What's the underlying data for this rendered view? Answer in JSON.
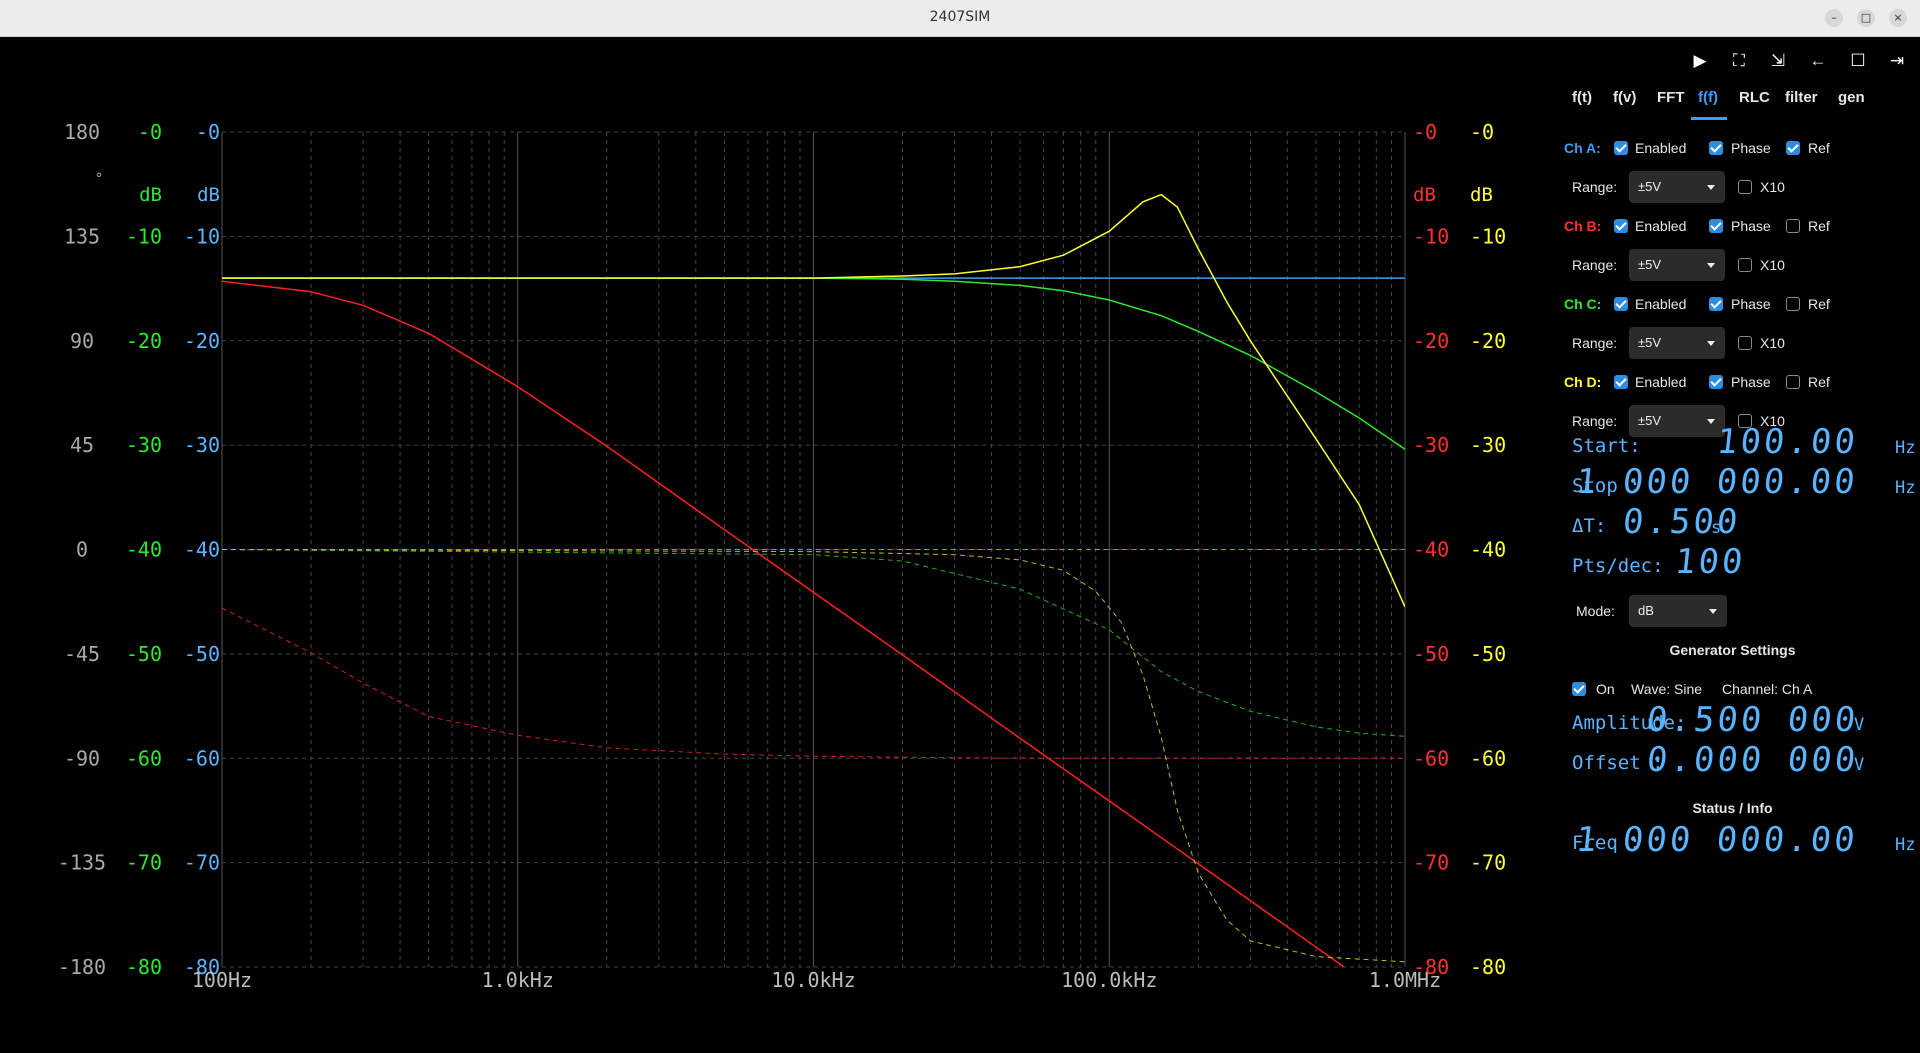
{
  "window": {
    "title": "2407SIM"
  },
  "toolbar": {
    "icons": [
      "play-icon",
      "fullscreen-icon",
      "collapse-icon",
      "back-arrow-icon",
      "window-icon",
      "exit-icon"
    ]
  },
  "tabs": [
    {
      "label": "f(t)"
    },
    {
      "label": "f(v)"
    },
    {
      "label": "FFT"
    },
    {
      "label": "f(f)",
      "active": true
    },
    {
      "label": "RLC"
    },
    {
      "label": "filter"
    },
    {
      "label": "gen"
    }
  ],
  "channels": [
    {
      "label": "Ch A:",
      "color": "#3a9ff5",
      "enabled": true,
      "phase": true,
      "ref": true,
      "range": "±5V",
      "x10": false
    },
    {
      "label": "Ch B:",
      "color": "#ff3030",
      "enabled": true,
      "phase": true,
      "ref": false,
      "range": "±5V",
      "x10": false
    },
    {
      "label": "Ch C:",
      "color": "#2ee82e",
      "enabled": true,
      "phase": true,
      "ref": false,
      "range": "±5V",
      "x10": false
    },
    {
      "label": "Ch D:",
      "color": "#ffff33",
      "enabled": true,
      "phase": true,
      "ref": false,
      "range": "±5V",
      "x10": false
    }
  ],
  "labels": {
    "enabled": "Enabled",
    "phase": "Phase",
    "ref": "Ref",
    "range": "Range:",
    "x10": "X10",
    "mode": "Mode:",
    "on": "On"
  },
  "sweep": {
    "start_label": "Start:",
    "start_value": "100.00",
    "start_unit": "Hz",
    "stop_label": "Stop :",
    "stop_value": "1 000 000.00",
    "stop_unit": "Hz",
    "dt_label": "ΔT:",
    "dt_value": "0.500",
    "dt_unit": "s",
    "pts_label": "Pts/dec:",
    "pts_value": "100",
    "mode_value": "dB"
  },
  "generator": {
    "heading": "Generator Settings",
    "on": true,
    "wave": "Wave: Sine",
    "channel": "Channel: Ch A",
    "amp_label": "Amplitude:",
    "amp_value": "0.500 000",
    "amp_unit": "V",
    "off_label": "Offset   :",
    "off_value": "0.000 000",
    "off_unit": "V"
  },
  "status": {
    "heading": "Status / Info",
    "freq_label": "Freq :",
    "freq_value": "1 000 000.00",
    "freq_unit": "Hz"
  },
  "chart_data": {
    "type": "line",
    "x_scale": "log",
    "xlim": [
      100,
      1000000
    ],
    "x_ticks": [
      "100Hz",
      "1.0kHz",
      "10.0kHz",
      "100.0kHz",
      "1.0MHz"
    ],
    "axes": [
      {
        "side": "left",
        "color": "#aaaaaa",
        "unit": "°",
        "ticks": [
          "180",
          "135",
          "90",
          "45",
          "0",
          "-45",
          "-90",
          "-135",
          "-180"
        ]
      },
      {
        "side": "left",
        "color": "#2ee82e",
        "unit": "dB",
        "ticks": [
          "-0",
          "-10",
          "-20",
          "-30",
          "-40",
          "-50",
          "-60",
          "-70",
          "-80"
        ]
      },
      {
        "side": "left",
        "color": "#5ab4ff",
        "unit": "dB",
        "ticks": [
          "-0",
          "-10",
          "-20",
          "-30",
          "-40",
          "-50",
          "-60",
          "-70",
          "-80"
        ]
      },
      {
        "side": "right",
        "color": "#ff3030",
        "unit": "dB",
        "ticks": [
          "-0",
          "-10",
          "-20",
          "-30",
          "-40",
          "-50",
          "-60",
          "-70",
          "-80"
        ]
      },
      {
        "side": "right",
        "color": "#ffff33",
        "unit": "dB",
        "ticks": [
          "-0",
          "-10",
          "-20",
          "-30",
          "-40",
          "-50",
          "-60",
          "-70",
          "-80"
        ]
      }
    ],
    "grid": true,
    "series": [
      {
        "channel": "A",
        "kind": "magnitude",
        "color": "#3a9ff5",
        "x": [
          100,
          1000000
        ],
        "y": [
          -14,
          -14
        ]
      },
      {
        "channel": "A",
        "kind": "phase",
        "color": "#3a9ff5",
        "dashed": true,
        "x": [
          100,
          1000000
        ],
        "y": [
          -40,
          -40
        ]
      },
      {
        "channel": "B",
        "kind": "magnitude",
        "color": "#ff2020",
        "x": [
          100,
          200,
          300,
          500,
          1000,
          2000,
          5000,
          10000,
          20000,
          50000,
          100000,
          200000,
          500000,
          1000000
        ],
        "y": [
          -14.3,
          -15.3,
          -16.6,
          -19.3,
          -24.4,
          -30.1,
          -38.1,
          -44.1,
          -50.1,
          -58.1,
          -64.1,
          -70.1,
          -78.1,
          -84.1
        ]
      },
      {
        "channel": "B",
        "kind": "phase",
        "color": "#cc2020",
        "dashed": true,
        "x": [
          100,
          200,
          300,
          500,
          1000,
          2000,
          5000,
          10000,
          20000,
          50000,
          100000,
          1000000
        ],
        "y": [
          -45.6,
          -49.9,
          -52.8,
          -56.0,
          -57.8,
          -59.0,
          -59.6,
          -59.8,
          -59.9,
          -60,
          -60,
          -60
        ]
      },
      {
        "channel": "C",
        "kind": "magnitude",
        "color": "#2ee82e",
        "x": [
          100,
          10000,
          20000,
          30000,
          50000,
          70000,
          100000,
          150000,
          200000,
          300000,
          500000,
          700000,
          1000000
        ],
        "y": [
          -14,
          -14,
          -14.1,
          -14.3,
          -14.7,
          -15.2,
          -16.1,
          -17.6,
          -19.1,
          -21.4,
          -24.9,
          -27.4,
          -30.4
        ]
      },
      {
        "channel": "C",
        "kind": "phase",
        "color": "#22aa22",
        "dashed": true,
        "x": [
          100,
          10000,
          20000,
          50000,
          100000,
          150000,
          200000,
          300000,
          500000,
          700000,
          1000000
        ],
        "y": [
          -40,
          -40.5,
          -41.1,
          -43.8,
          -47.7,
          -51.7,
          -53.6,
          -55.5,
          -57.0,
          -57.6,
          -57.9
        ]
      },
      {
        "channel": "D",
        "kind": "magnitude",
        "color": "#ffff33",
        "x": [
          100,
          10000,
          20000,
          30000,
          50000,
          70000,
          100000,
          130000,
          150000,
          170000,
          200000,
          250000,
          300000,
          500000,
          700000,
          1000000
        ],
        "y": [
          -14,
          -14,
          -13.8,
          -13.6,
          -12.9,
          -11.8,
          -9.5,
          -6.7,
          -6.0,
          -7.2,
          -11.2,
          -16.3,
          -20.0,
          -29.4,
          -35.7,
          -45.5
        ]
      },
      {
        "channel": "D",
        "kind": "phase",
        "color": "#bbbb22",
        "dashed": true,
        "x": [
          100,
          10000,
          30000,
          50000,
          70000,
          90000,
          110000,
          130000,
          150000,
          170000,
          200000,
          250000,
          300000,
          500000,
          1000000
        ],
        "y": [
          -40,
          -40.2,
          -40.5,
          -41,
          -42,
          -44,
          -47,
          -52,
          -58,
          -65,
          -71,
          -75.5,
          -77.5,
          -79,
          -79.5
        ]
      }
    ]
  }
}
